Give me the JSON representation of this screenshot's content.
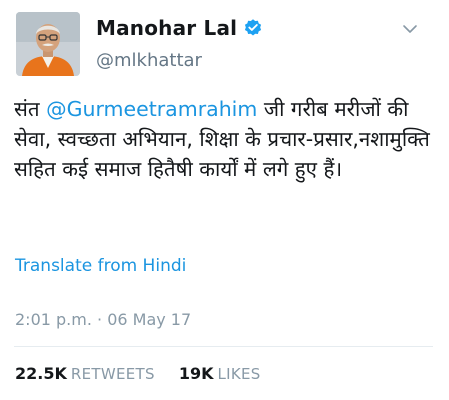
{
  "tweet": {
    "author": {
      "display_name": "Manohar Lal",
      "handle": "@mlkhattar",
      "verified_icon": "verified-badge-icon",
      "avatar_icon": "profile-photo"
    },
    "body": {
      "prefix": "संत ",
      "mention": "@Gurmeetramrahim",
      "suffix": " जी गरीब मरीजों की सेवा, स्वच्छता अभियान, शिक्षा के प्रचार-प्रसार,नशामुक्ति सहित कई समाज हितैषी कार्यों में लगे हुए हैं।"
    },
    "translate_label": "Translate from Hindi",
    "timestamp": "2:01 p.m. · 06 May 17",
    "stats": {
      "retweets_count": "22.5K",
      "retweets_label": "RETWEETS",
      "likes_count": "19K",
      "likes_label": "LIKES"
    },
    "menu_icon": "chevron-down-icon"
  },
  "colors": {
    "link": "#1b95e0",
    "secondary_text": "#657786",
    "muted_text": "#8899a6",
    "divider": "#e6ecf0",
    "verified": "#1da1f2"
  }
}
